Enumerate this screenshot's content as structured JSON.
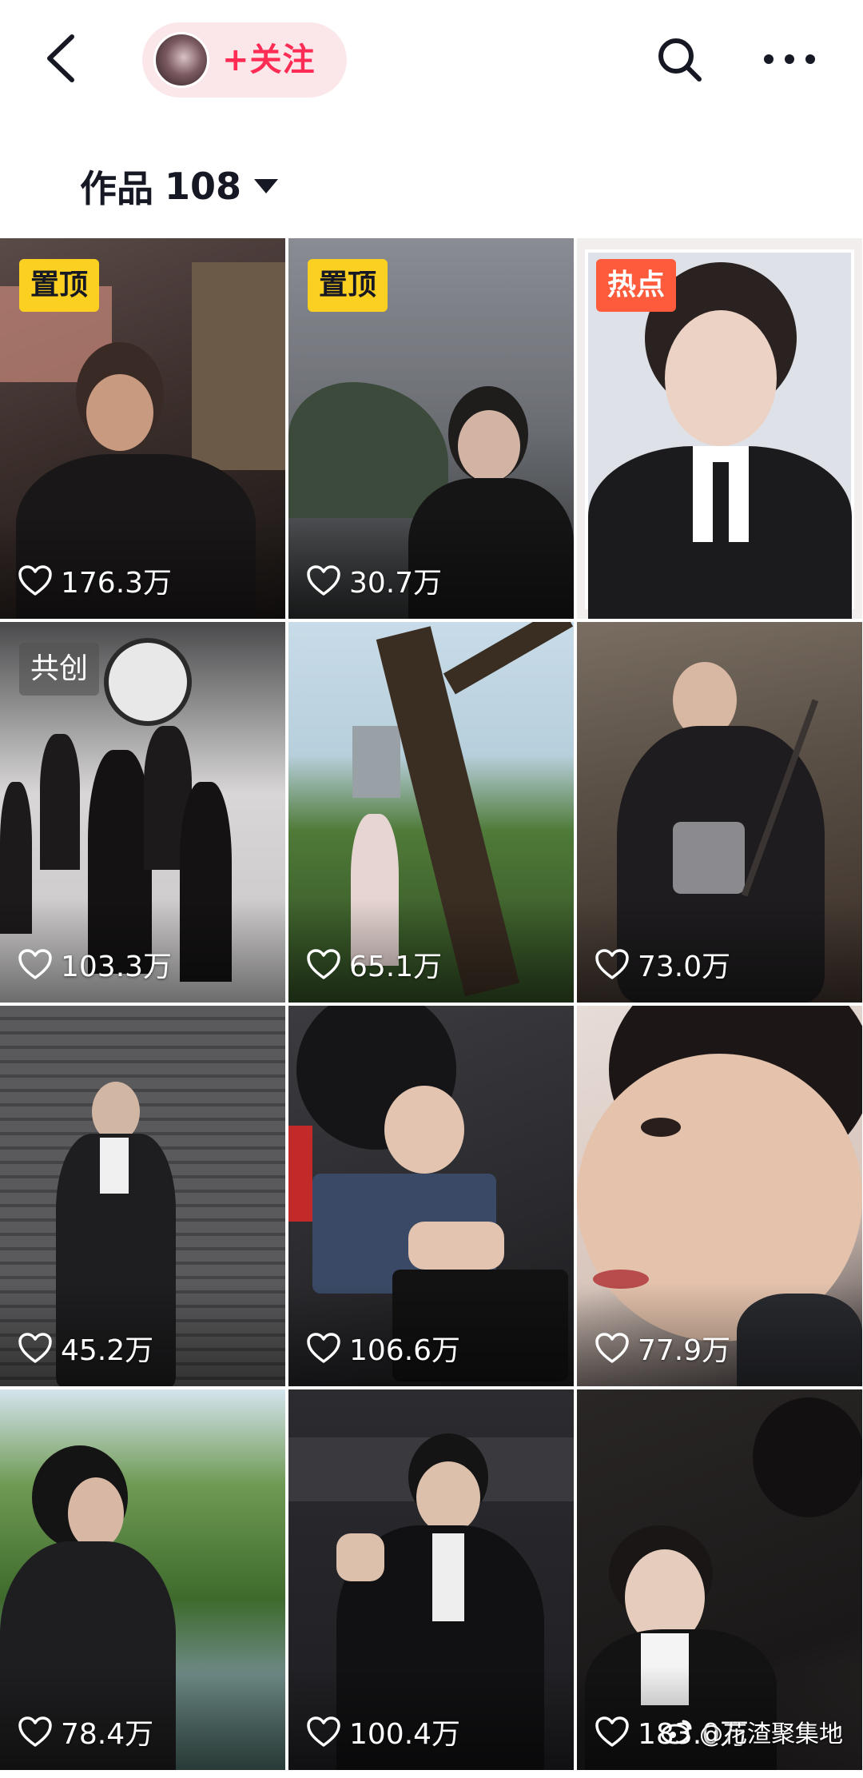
{
  "topbar": {
    "back_icon": "chevron-left-icon",
    "follow_label": "+关注",
    "search_icon": "search-icon",
    "more_icon": "more-dots-icon"
  },
  "works": {
    "label": "作品",
    "count": "108",
    "dropdown_icon": "caret-down-icon"
  },
  "videos": [
    {
      "badge": "置顶",
      "likes": "176.3万"
    },
    {
      "badge": "置顶",
      "likes": "30.7万"
    },
    {
      "badge": "热点",
      "likes": ""
    },
    {
      "badge": "共创",
      "likes": "103.3万"
    },
    {
      "badge": "",
      "likes": "65.1万"
    },
    {
      "badge": "",
      "likes": "73.0万"
    },
    {
      "badge": "",
      "likes": "45.2万"
    },
    {
      "badge": "",
      "likes": "106.6万"
    },
    {
      "badge": "",
      "likes": "77.9万"
    },
    {
      "badge": "",
      "likes": "78.4万"
    },
    {
      "badge": "",
      "likes": "100.4万"
    },
    {
      "badge": "",
      "likes": "183.0万"
    }
  ],
  "watermark": "@花渣聚集地",
  "colors": {
    "accent": "#fe2c55",
    "pin_badge": "#fbd020",
    "hot_badge": "#fe5a3c"
  }
}
